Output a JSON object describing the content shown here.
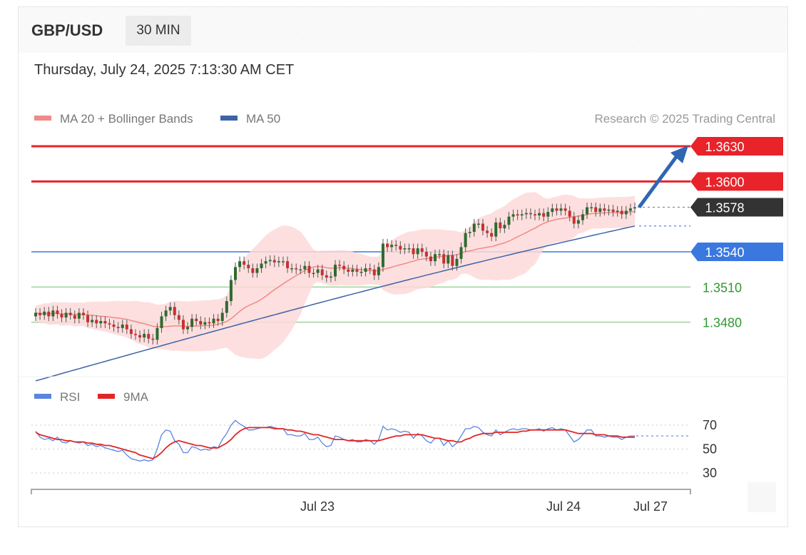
{
  "header": {
    "pair": "GBP/USD",
    "timeframe": "30 MIN",
    "datetime": "Thursday, July 24, 2025 7:13:30 AM CET"
  },
  "legend": {
    "ma20_label": "MA 20 + Bollinger Bands",
    "ma50_label": "MA 50",
    "copyright": "Research © 2025 Trading Central"
  },
  "rsi_legend": {
    "rsi_label": "RSI",
    "ma9_label": "9MA"
  },
  "colors": {
    "resistance": "#e8232a",
    "pivot": "#3a78e0",
    "support": "#9ed39a",
    "support_text": "#2e9a2e",
    "current": "#333333",
    "ma20": "#f08a86",
    "ma50": "#3d63a8",
    "bollinger": "#fdd9d9",
    "arrow": "#2f66b3",
    "candle_up": "#2e6b2e",
    "candle_down": "#c8302f",
    "rsi": "#5b84de",
    "rsi_ma": "#e22626"
  },
  "chart_data": [
    {
      "type": "candlestick",
      "title": "GBP/USD 30 MIN",
      "ylim": [
        1.342,
        1.365
      ],
      "x_ticks": [
        "Jul 23",
        "Jul 24",
        "Jul 27"
      ],
      "levels": [
        {
          "kind": "resistance",
          "value": 1.363,
          "label": "1.3630"
        },
        {
          "kind": "resistance",
          "value": 1.36,
          "label": "1.3600"
        },
        {
          "kind": "current",
          "value": 1.3578,
          "label": "1.3578"
        },
        {
          "kind": "pivot",
          "value": 1.354,
          "label": "1.3540"
        },
        {
          "kind": "support",
          "value": 1.351,
          "label": "1.3510"
        },
        {
          "kind": "support",
          "value": 1.348,
          "label": "1.3480"
        }
      ],
      "close": [
        1.3488,
        1.3486,
        1.3489,
        1.3485,
        1.349,
        1.3487,
        1.3484,
        1.3488,
        1.3486,
        1.3483,
        1.3488,
        1.3486,
        1.348,
        1.3482,
        1.3479,
        1.3481,
        1.3479,
        1.3478,
        1.3476,
        1.3475,
        1.3478,
        1.3474,
        1.347,
        1.3469,
        1.3467,
        1.347,
        1.3466,
        1.3465,
        1.3475,
        1.3485,
        1.349,
        1.3493,
        1.3486,
        1.3482,
        1.3474,
        1.3476,
        1.3483,
        1.3481,
        1.3478,
        1.348,
        1.3479,
        1.3483,
        1.3481,
        1.3488,
        1.3498,
        1.3516,
        1.3527,
        1.3532,
        1.3529,
        1.3526,
        1.3522,
        1.3526,
        1.353,
        1.3532,
        1.3533,
        1.3531,
        1.3532,
        1.3532,
        1.3526,
        1.3526,
        1.3525,
        1.3525,
        1.3528,
        1.3522,
        1.3522,
        1.3525,
        1.352,
        1.3518,
        1.3519,
        1.3529,
        1.3528,
        1.3525,
        1.3523,
        1.3525,
        1.3523,
        1.3523,
        1.3526,
        1.3525,
        1.352,
        1.3527,
        1.3547,
        1.3544,
        1.3546,
        1.3545,
        1.3542,
        1.3543,
        1.3543,
        1.3538,
        1.3543,
        1.354,
        1.3536,
        1.3532,
        1.3538,
        1.3538,
        1.353,
        1.3537,
        1.3528,
        1.3534,
        1.3544,
        1.3556,
        1.3557,
        1.3564,
        1.3564,
        1.3558,
        1.3556,
        1.3553,
        1.3565,
        1.356,
        1.3563,
        1.357,
        1.3572,
        1.3571,
        1.3572,
        1.3573,
        1.3572,
        1.3571,
        1.3573,
        1.357,
        1.3574,
        1.3577,
        1.3575,
        1.3577,
        1.3575,
        1.357,
        1.3564,
        1.3567,
        1.3572,
        1.3578,
        1.3578,
        1.3574,
        1.3577,
        1.3575,
        1.3576,
        1.3574,
        1.3575,
        1.3572,
        1.3575,
        1.3577,
        1.3578
      ]
    },
    {
      "type": "line",
      "title": "RSI",
      "ylim": [
        25,
        80
      ],
      "y_ticks": [
        70,
        50,
        30
      ],
      "series": [
        {
          "name": "RSI",
          "values": [
            65,
            60,
            58,
            59,
            57,
            60,
            56,
            55,
            57,
            56,
            55,
            56,
            53,
            54,
            52,
            53,
            51,
            50,
            49,
            48,
            49,
            45,
            42,
            41,
            40,
            41,
            40,
            41,
            50,
            62,
            66,
            65,
            57,
            54,
            47,
            47,
            52,
            51,
            49,
            50,
            49,
            52,
            51,
            58,
            63,
            70,
            74,
            71,
            69,
            66,
            66,
            67,
            68,
            68,
            69,
            68,
            67,
            67,
            62,
            62,
            61,
            61,
            63,
            58,
            58,
            60,
            55,
            52,
            53,
            61,
            60,
            58,
            57,
            58,
            56,
            56,
            58,
            57,
            54,
            58,
            69,
            66,
            67,
            66,
            64,
            65,
            64,
            59,
            63,
            61,
            57,
            55,
            59,
            59,
            53,
            57,
            52,
            55,
            61,
            67,
            67,
            69,
            68,
            64,
            62,
            61,
            66,
            62,
            64,
            66,
            67,
            66,
            67,
            67,
            66,
            66,
            67,
            65,
            67,
            68,
            66,
            67,
            66,
            61,
            56,
            58,
            62,
            66,
            66,
            61,
            61,
            60,
            61,
            60,
            60,
            58,
            60,
            61,
            61
          ]
        },
        {
          "name": "9MA",
          "values": [
            64,
            62,
            61,
            60,
            59,
            58,
            58,
            57,
            57,
            56,
            56,
            56,
            55,
            55,
            54,
            54,
            53,
            53,
            52,
            51,
            50,
            49,
            48,
            47,
            45,
            44,
            43,
            42,
            44,
            47,
            51,
            54,
            56,
            57,
            56,
            55,
            54,
            53,
            53,
            52,
            51,
            51,
            51,
            53,
            55,
            58,
            62,
            65,
            67,
            68,
            68,
            68,
            68,
            68,
            68,
            67,
            67,
            67,
            66,
            66,
            65,
            65,
            64,
            63,
            62,
            62,
            61,
            60,
            59,
            58,
            58,
            58,
            57,
            57,
            57,
            57,
            57,
            57,
            57,
            57,
            58,
            59,
            60,
            61,
            61,
            62,
            62,
            62,
            62,
            62,
            61,
            60,
            59,
            59,
            58,
            57,
            57,
            56,
            56,
            58,
            59,
            61,
            62,
            63,
            63,
            63,
            64,
            64,
            64,
            64,
            64,
            64,
            65,
            65,
            66,
            66,
            66,
            66,
            66,
            66,
            66,
            66,
            66,
            65,
            64,
            63,
            63,
            63,
            63,
            62,
            62,
            62,
            61,
            61,
            61,
            60,
            60,
            60,
            60
          ]
        }
      ]
    }
  ]
}
